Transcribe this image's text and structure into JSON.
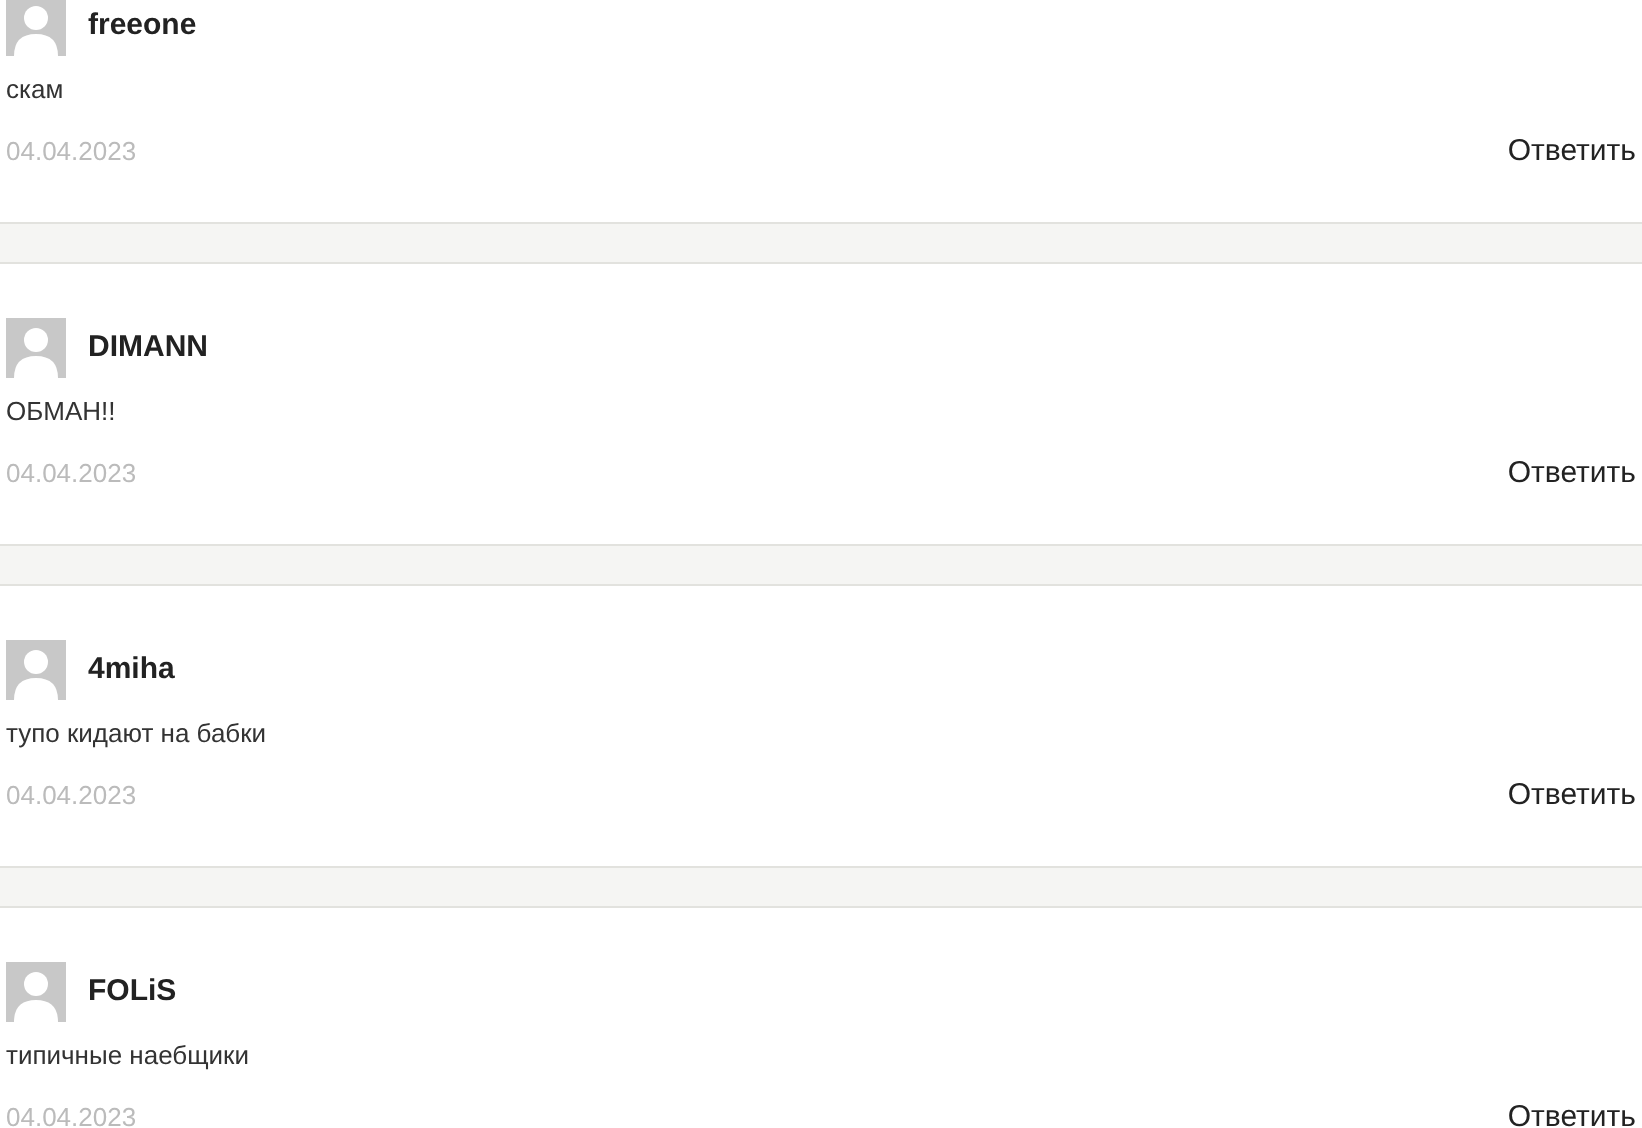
{
  "comments": [
    {
      "author": "freeone",
      "text": "скам",
      "date": "04.04.2023",
      "reply": "Ответить"
    },
    {
      "author": "DIMANN",
      "text": "ОБМАН!!",
      "date": "04.04.2023",
      "reply": "Ответить"
    },
    {
      "author": "4miha",
      "text": "тупо кидают на бабки",
      "date": "04.04.2023",
      "reply": "Ответить"
    },
    {
      "author": "FOLiS",
      "text": "типичные наебщики",
      "date": "04.04.2023",
      "reply": "Ответить"
    }
  ]
}
